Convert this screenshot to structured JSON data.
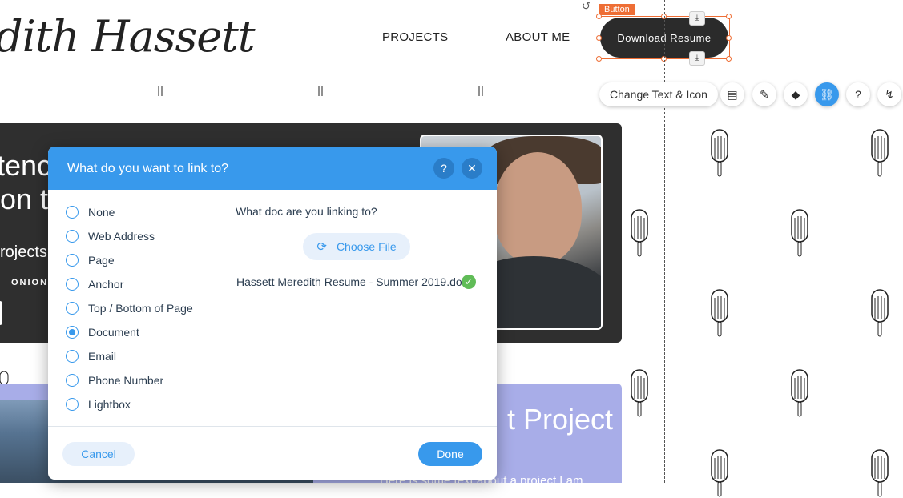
{
  "header": {
    "logo_text": "dith Hassett",
    "nav": [
      "PROJECTS",
      "ABOUT ME"
    ],
    "cta_label": "Download Resume",
    "selection_tag": "Button"
  },
  "toolbar": {
    "change_text_label": "Change Text & Icon",
    "icons": [
      "layout-icon",
      "design-brush-icon",
      "animation-icon",
      "link-icon",
      "help-icon",
      "connect-icon"
    ]
  },
  "background": {
    "hero_line1": "tenc",
    "hero_line2": "on t",
    "projects_text": "rojects",
    "onions_text": "ONIONS",
    "purple_title": "t Project",
    "purple_sub": "Here is some text about a project Lam"
  },
  "dialog": {
    "title": "What do you want to link to?",
    "options": [
      "None",
      "Web Address",
      "Page",
      "Anchor",
      "Top / Bottom of Page",
      "Document",
      "Email",
      "Phone Number",
      "Lightbox"
    ],
    "selected_option": "Document",
    "question": "What doc are you linking to?",
    "choose_file_label": "Choose File",
    "file_name": "Hassett Meredith Resume - Summer 2019.do",
    "cancel_label": "Cancel",
    "done_label": "Done"
  },
  "colors": {
    "accent": "#3899ec",
    "selection": "#ee6e35",
    "success": "#60bc57"
  }
}
